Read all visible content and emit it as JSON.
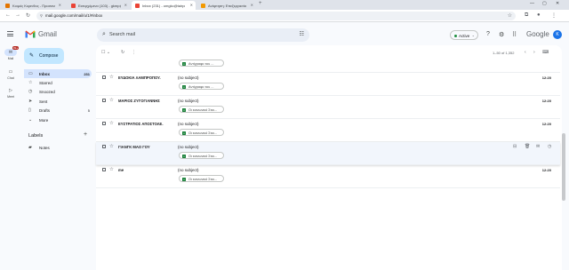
{
  "browser": {
    "tabs": [
      {
        "title": "Κοιμός Κορινθος - Προσανατολισμός",
        "fav_color": "#e37400"
      },
      {
        "title": "Εισερχόμενα (103) - gkmp@ebbsite",
        "fav_color": "#ea4335"
      },
      {
        "title": "Inbox (231) - omgkc@tairpotto",
        "fav_color": "#ea4335"
      },
      {
        "title": "Ανάρτηση: Επεξεργασία",
        "fav_color": "#f29900"
      }
    ],
    "new_tab_symbol": "+",
    "url": "mail.google.com/mail/u/1/#inbox"
  },
  "header": {
    "brand": "Gmail",
    "search_placeholder": "Search mail",
    "status": "Active",
    "google_brand": "Google",
    "avatar_letter": "K"
  },
  "rail": [
    {
      "label": "Mail",
      "icon": "✉",
      "badge": "99+"
    },
    {
      "label": "Chat",
      "icon": "▭",
      "badge": ""
    },
    {
      "label": "Meet",
      "icon": "▷",
      "badge": ""
    }
  ],
  "compose_label": "Compose",
  "nav": [
    {
      "label": "Inbox",
      "count": "231",
      "icon": "▭"
    },
    {
      "label": "Starred",
      "count": "",
      "icon": "☆"
    },
    {
      "label": "Snoozed",
      "count": "",
      "icon": "◷"
    },
    {
      "label": "Sent",
      "count": "",
      "icon": "➤"
    },
    {
      "label": "Drafts",
      "count": "5",
      "icon": "▯"
    },
    {
      "label": "More",
      "count": "",
      "icon": "⌄"
    }
  ],
  "labels": {
    "heading": "Labels",
    "items": [
      {
        "label": "Notes",
        "icon": "▰"
      }
    ]
  },
  "toolbar": {
    "pagination": "1–50 of 1,352",
    "input_tools": "⌨"
  },
  "emails": [
    {
      "sender": "",
      "subject": "",
      "time": "",
      "attachment": "Αντίγραφο του ..."
    },
    {
      "sender": "ΕΥΔΟΚΙΑ ΛΑΜΠΡΟΠΟΥ.",
      "subject": "(no subject)",
      "time": "12:20",
      "attachment": "Αντίγραφο του ..."
    },
    {
      "sender": "ΜΑΡΙΟΣ ΖΥΓΟΓΙΑΝΝΗΣ",
      "subject": "(no subject)",
      "time": "12:20",
      "attachment": "Οι κοινωνικό Στοι..."
    },
    {
      "sender": "ΕΥΣΤΡΑΤΙΟΣ ΑΠΟΣΤΟΛΕ.",
      "subject": "(no subject)",
      "time": "12:20",
      "attachment": "Οι κοινωνικό Στοι..."
    },
    {
      "sender": "ΓΙΑΝΓΚ ΜΑΟ ΓΟΥ",
      "subject": "(no subject)",
      "time": "",
      "attachment": "Οι κοινωνικό Στοι..."
    },
    {
      "sender": "me",
      "subject": "(no subject)",
      "time": "12:20",
      "attachment": "Οι κοινωνικό Στοι..."
    }
  ]
}
